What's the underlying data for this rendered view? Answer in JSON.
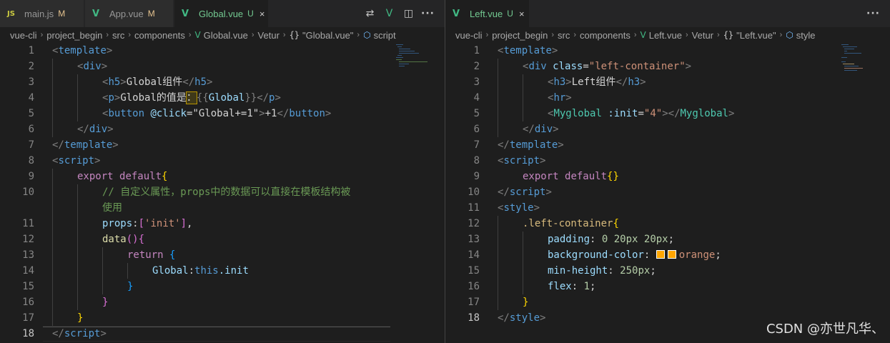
{
  "left_pane": {
    "tabs": [
      {
        "icon": "JS",
        "label": "main.js",
        "status": "M"
      },
      {
        "icon": "V",
        "label": "App.vue",
        "status": "M"
      },
      {
        "icon": "V",
        "label": "Global.vue",
        "status": "U",
        "close": "×"
      }
    ],
    "actions": {
      "compare_icon": "⇄",
      "vue_icon": "V",
      "split_icon": "◫",
      "more_icon": "···"
    },
    "breadcrumb": {
      "items": [
        "vue-cli",
        "project_begin",
        "src",
        "components",
        "Global.vue",
        "Vetur",
        "\"Global.vue\"",
        "script"
      ],
      "separator": "›",
      "symbol_glyph": "{}",
      "style_glyph": "⬡"
    },
    "line_numbers": [
      "1",
      "2",
      "3",
      "4",
      "5",
      "6",
      "7",
      "8",
      "9",
      "10",
      "11",
      "12",
      "13",
      "14",
      "15",
      "16",
      "17",
      "18"
    ]
  },
  "right_pane": {
    "tabs": [
      {
        "icon": "V",
        "label": "Left.vue",
        "status": "U",
        "close": "×"
      }
    ],
    "actions": {
      "more_icon": "···"
    },
    "breadcrumb": {
      "items": [
        "vue-cli",
        "project_begin",
        "src",
        "components",
        "Left.vue",
        "Vetur",
        "\"Left.vue\"",
        "style"
      ],
      "separator": "›",
      "symbol_glyph": "{}",
      "style_glyph": "⬡"
    },
    "line_numbers": [
      "1",
      "2",
      "3",
      "4",
      "5",
      "6",
      "7",
      "8",
      "9",
      "10",
      "11",
      "12",
      "13",
      "14",
      "15",
      "16",
      "17",
      "18"
    ]
  },
  "code": {
    "lt": "<",
    "gt": ">",
    "lt_slash": "</",
    "eq": "=",
    "template": "template",
    "div": "div",
    "h5": "h5",
    "h3": "h3",
    "p": "p",
    "hr": "hr",
    "button": "button",
    "script": "script",
    "style": "style",
    "global_h5_text": "Global组件",
    "global_p_text": "Global的值是",
    "fullwidth_colon": "：",
    "mustache_open": "{{",
    "mustache_close": "}}",
    "global_name": "Global",
    "click_attr": "@click",
    "click_value": "\"Global+=1\"",
    "button_text": "+1",
    "export_kw": "export",
    "default_kw": "default",
    "brace_open": "{",
    "brace_close": "}",
    "comment_part1": "// 自定义属性，props中的数据可以直接在模板结构被",
    "comment_part2": "使用",
    "props_key": "props",
    "colon": ":",
    "bracket_open": "[",
    "bracket_close": "]",
    "init_str": "'init'",
    "comma": ",",
    "data_fn": "data",
    "parens": "()",
    "return_kw": "return",
    "global_key": "Global",
    "this_kw": "this",
    "dot_init": ".init",
    "class_attr": "class",
    "left_container_value": "\"left-container\"",
    "left_h3_text": "Left组件",
    "myglobal": "Myglobal",
    "init_attr": ":init",
    "init_value": "\"4\"",
    "empty_braces": "{}",
    "css_selector": ".left-container",
    "padding_prop": "padding",
    "padding_value": "0 20px 20px",
    "bg_prop": "background-color",
    "bg_value": "orange",
    "minheight_prop": "min-height",
    "minheight_value": "250px",
    "flex_prop": "flex",
    "flex_value": "1",
    "semicolon": ";"
  },
  "colors": {
    "vue_green": "#41b883",
    "modified": "#e2c08d",
    "untracked": "#73c991",
    "orange_swatch": "#ffa500"
  },
  "watermark": "CSDN @亦世凡华、"
}
